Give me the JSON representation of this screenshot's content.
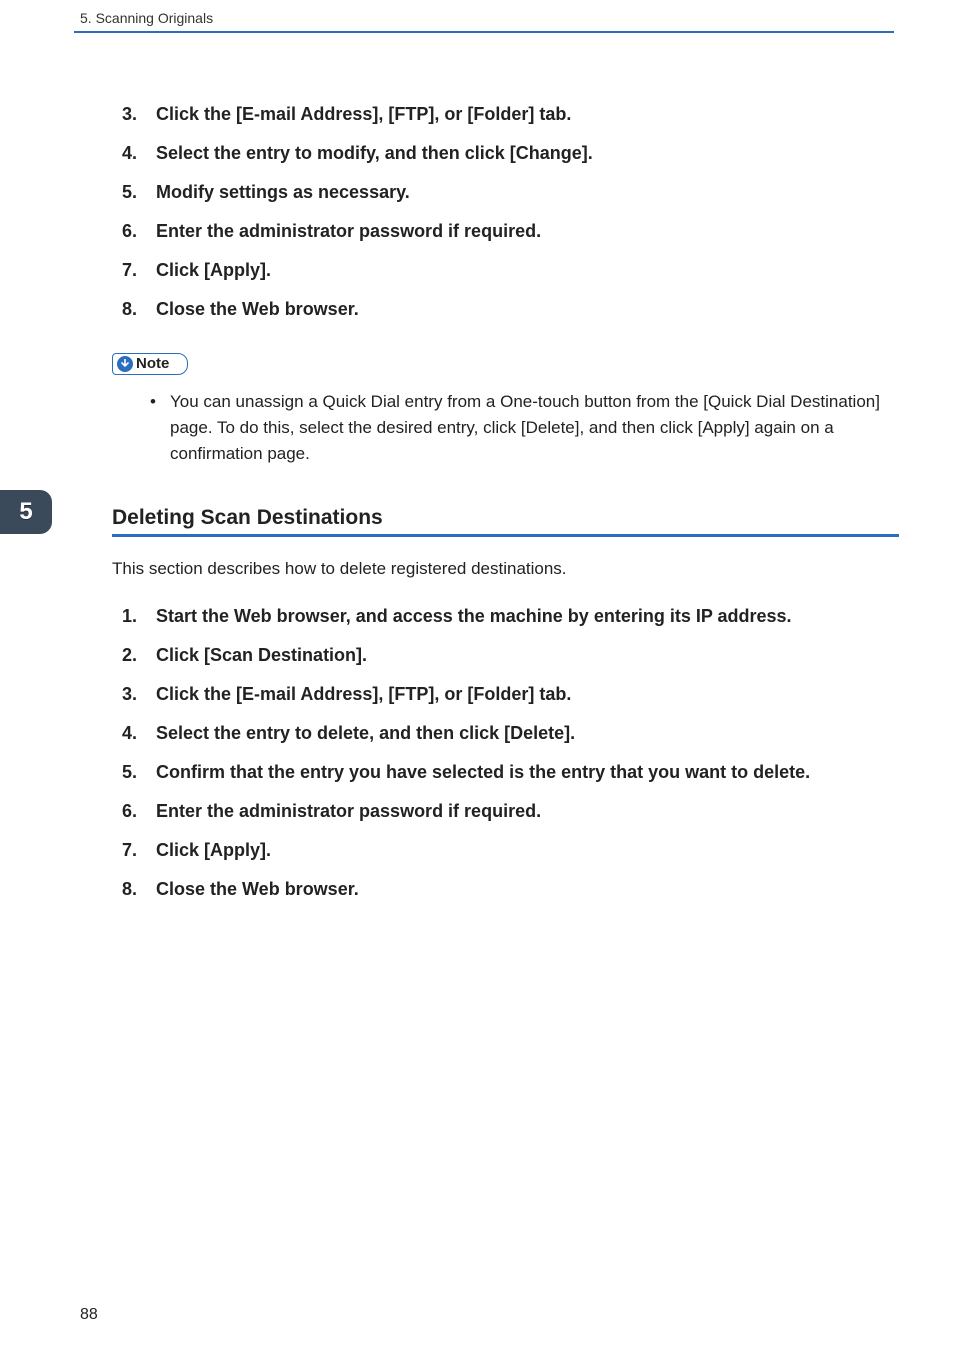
{
  "header": {
    "running_title": "5. Scanning Originals"
  },
  "first_steps": [
    {
      "num": "3.",
      "text": "Click the [E-mail Address], [FTP], or [Folder] tab."
    },
    {
      "num": "4.",
      "text": "Select the entry to modify, and then click [Change]."
    },
    {
      "num": "5.",
      "text": "Modify settings as necessary."
    },
    {
      "num": "6.",
      "text": "Enter the administrator password if required."
    },
    {
      "num": "7.",
      "text": "Click [Apply]."
    },
    {
      "num": "8.",
      "text": "Close the Web browser."
    }
  ],
  "note": {
    "label": "Note",
    "items": [
      "You can unassign a Quick Dial entry from a One-touch button from the [Quick Dial Destination] page. To do this, select the desired entry, click [Delete], and then click [Apply] again on a confirmation page."
    ]
  },
  "section": {
    "heading": "Deleting Scan Destinations",
    "lead": "This section describes how to delete registered destinations.",
    "steps": [
      {
        "num": "1.",
        "text": "Start the Web browser, and access the machine by entering its IP address."
      },
      {
        "num": "2.",
        "text": "Click [Scan Destination]."
      },
      {
        "num": "3.",
        "text": "Click the [E-mail Address], [FTP], or [Folder] tab."
      },
      {
        "num": "4.",
        "text": "Select the entry to delete, and then click [Delete]."
      },
      {
        "num": "5.",
        "text": "Confirm that the entry you have selected is the entry that you want to delete."
      },
      {
        "num": "6.",
        "text": "Enter the administrator password if required."
      },
      {
        "num": "7.",
        "text": "Click [Apply]."
      },
      {
        "num": "8.",
        "text": "Close the Web browser."
      }
    ]
  },
  "chapter_tab": "5",
  "page_number": "88"
}
